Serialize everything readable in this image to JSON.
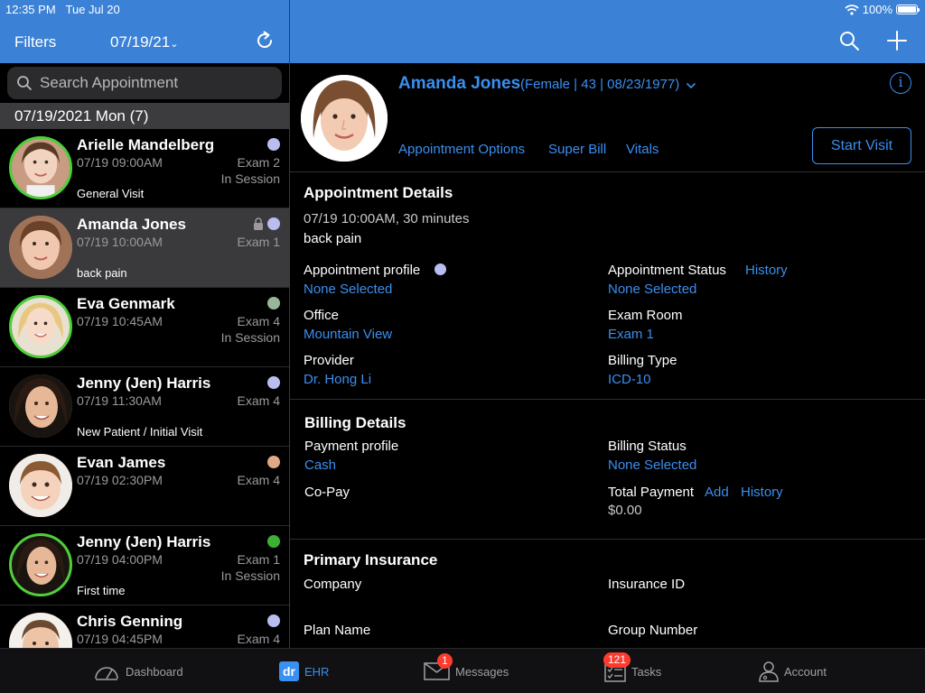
{
  "status_bar": {
    "time": "12:35 PM",
    "date": "Tue Jul 20",
    "battery": "100%"
  },
  "left_header": {
    "filters_label": "Filters",
    "date_filter": "07/19/21"
  },
  "search": {
    "placeholder": "Search Appointment"
  },
  "list_date_header": "07/19/2021 Mon (7)",
  "appointments": [
    {
      "name": "Arielle Mandelberg",
      "time": "07/19 09:00AM",
      "room": "Exam 2",
      "session": "In Session",
      "reason": "General Visit",
      "dot_color": "#b9bdf0"
    },
    {
      "name": "Amanda Jones",
      "time": "07/19 10:00AM",
      "room": "Exam 1",
      "session": "",
      "reason": "back pain",
      "dot_color": "#b9bdf0"
    },
    {
      "name": "Eva Genmark",
      "time": "07/19 10:45AM",
      "room": "Exam 4",
      "session": "In Session",
      "reason": "",
      "dot_color": "#9bb59a"
    },
    {
      "name": "Jenny (Jen) Harris",
      "time": "07/19 11:30AM",
      "room": "Exam 4",
      "session": "",
      "reason": "New Patient / Initial Visit",
      "dot_color": "#b9bdf0"
    },
    {
      "name": "Evan James",
      "time": "07/19 02:30PM",
      "room": "Exam 4",
      "session": "",
      "reason": "",
      "dot_color": "#e0a884"
    },
    {
      "name": "Jenny (Jen) Harris",
      "time": "07/19 04:00PM",
      "room": "Exam 1",
      "session": "In Session",
      "reason": "First time",
      "dot_color": "#3cb034"
    },
    {
      "name": "Chris Genning",
      "time": "07/19 04:45PM",
      "room": "Exam 4",
      "session": "",
      "reason": "",
      "dot_color": "#b9bdf0"
    }
  ],
  "patient": {
    "name": "Amanda Jones",
    "meta": "(Female | 43 | 08/23/1977)",
    "links": {
      "appointment_options": "Appointment Options",
      "super_bill": "Super Bill",
      "vitals": "Vitals"
    },
    "start_visit": "Start Visit"
  },
  "appointment_details": {
    "title": "Appointment Details",
    "datetime": "07/19 10:00AM, 30 minutes",
    "reason": "back pain",
    "profile_label": "Appointment profile",
    "profile_value": "None Selected",
    "status_label": "Appointment Status",
    "history_link": "History",
    "status_value": "None Selected",
    "office_label": "Office",
    "office_value": "Mountain View",
    "exam_room_label": "Exam Room",
    "exam_room_value": "Exam 1",
    "provider_label": "Provider",
    "provider_value": "Dr. Hong Li",
    "billing_type_label": "Billing Type",
    "billing_type_value": "ICD-10"
  },
  "billing_details": {
    "title": "Billing Details",
    "payment_profile_label": "Payment profile",
    "payment_profile_value": "Cash",
    "billing_status_label": "Billing Status",
    "billing_status_value": "None Selected",
    "copay_label": "Co-Pay",
    "total_payment_label": "Total Payment",
    "add_link": "Add",
    "history_link": "History",
    "total_payment_value": "$0.00"
  },
  "primary_insurance": {
    "title": "Primary Insurance",
    "company_label": "Company",
    "insurance_id_label": "Insurance ID",
    "plan_name_label": "Plan Name",
    "group_number_label": "Group Number"
  },
  "tabbar": {
    "dashboard": "Dashboard",
    "ehr": "EHR",
    "ehr_icon_text": "dr",
    "messages": "Messages",
    "messages_badge": "1",
    "tasks": "Tasks",
    "tasks_badge": "121",
    "account": "Account"
  },
  "colors": {
    "accent": "#3a8ff0",
    "header": "#3b82d6",
    "in_session_ring": "#4cd038"
  }
}
